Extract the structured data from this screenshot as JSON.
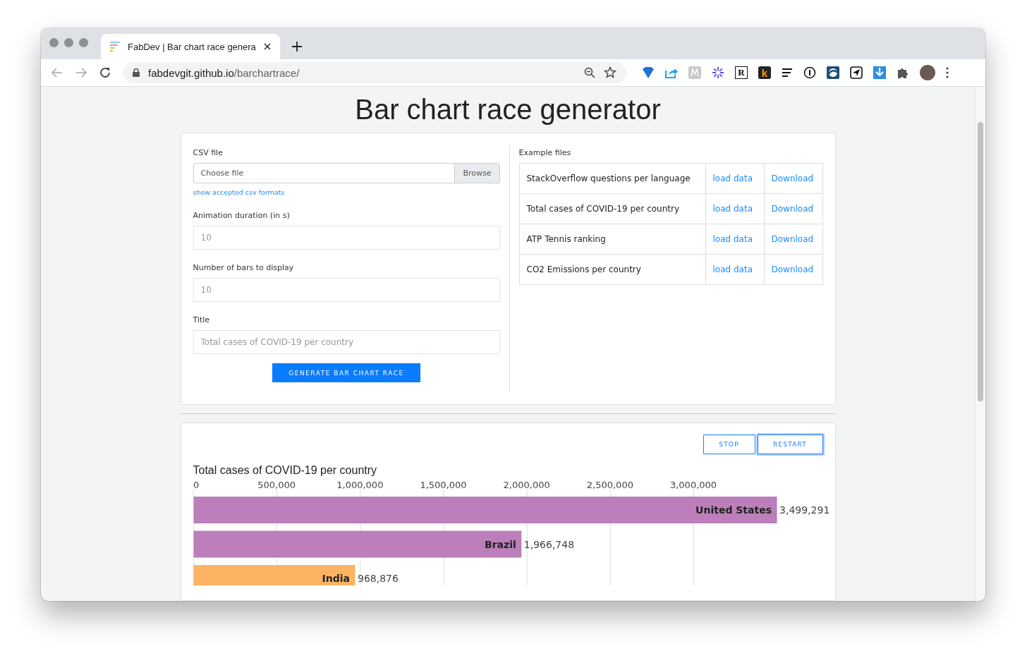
{
  "browser": {
    "tab": {
      "title": "FabDev | Bar chart race genera",
      "selected": true
    },
    "address": {
      "host": "fabdevgit.github.io",
      "path": "/barchartrace/"
    },
    "extensions": [
      {
        "kind": "diamond"
      },
      {
        "kind": "share"
      },
      {
        "kind": "mono"
      },
      {
        "kind": "burst"
      },
      {
        "kind": "letter-box",
        "text": "R"
      },
      {
        "kind": "letter-dark",
        "text": "k"
      },
      {
        "kind": "lines"
      },
      {
        "kind": "info"
      },
      {
        "kind": "globe"
      },
      {
        "kind": "send"
      },
      {
        "kind": "download"
      },
      {
        "kind": "puzzle"
      }
    ]
  },
  "page": {
    "heading": "Bar chart race generator",
    "form": {
      "csv_label": "CSV file",
      "file_placeholder": "Choose file",
      "browse": "Browse",
      "formats_link": "show accepted csv formats",
      "fields": [
        {
          "label": "Animation duration (in s)",
          "placeholder": "10"
        },
        {
          "label": "Number of bars to display",
          "placeholder": "10"
        },
        {
          "label": "Title",
          "placeholder": "Total cases of COVID-19 per country"
        }
      ],
      "generate": "GENERATE BAR CHART RACE"
    },
    "examples": {
      "label": "Example files",
      "rows": [
        {
          "name": "StackOverflow questions per language",
          "load": "load data",
          "download": "Download"
        },
        {
          "name": "Total cases of COVID-19 per country",
          "load": "load data",
          "download": "Download"
        },
        {
          "name": "ATP Tennis ranking",
          "load": "load data",
          "download": "Download"
        },
        {
          "name": "CO2 Emissions per country",
          "load": "load data",
          "download": "Download"
        }
      ]
    },
    "controls": [
      {
        "label": "STOP",
        "focused": false
      },
      {
        "label": "RESTART",
        "focused": true
      }
    ],
    "chart_data": {
      "type": "bar",
      "orientation": "horizontal",
      "title": "Total cases of COVID-19 per country",
      "categories": [
        "United States",
        "Brazil",
        "India"
      ],
      "series": [
        {
          "color": "#bc7fbb",
          "values": [
            3499291,
            1966748,
            null
          ]
        },
        {
          "color": "#fdb462",
          "values": [
            null,
            null,
            968876
          ]
        }
      ],
      "grid": true,
      "xlim": [
        0,
        3500000
      ],
      "value_labels": [
        "3,499,291",
        "1,966,748",
        "968,876"
      ],
      "xticks": [
        {
          "value": 0,
          "label": "0"
        },
        {
          "value": 500000,
          "label": "500,000"
        },
        {
          "value": 1000000,
          "label": "1,000,000"
        },
        {
          "value": 1500000,
          "label": "1,500,000"
        },
        {
          "value": 2000000,
          "label": "2,000,000"
        },
        {
          "value": 2500000,
          "label": "2,500,000"
        },
        {
          "value": 3000000,
          "label": "3,000,000"
        }
      ]
    }
  }
}
